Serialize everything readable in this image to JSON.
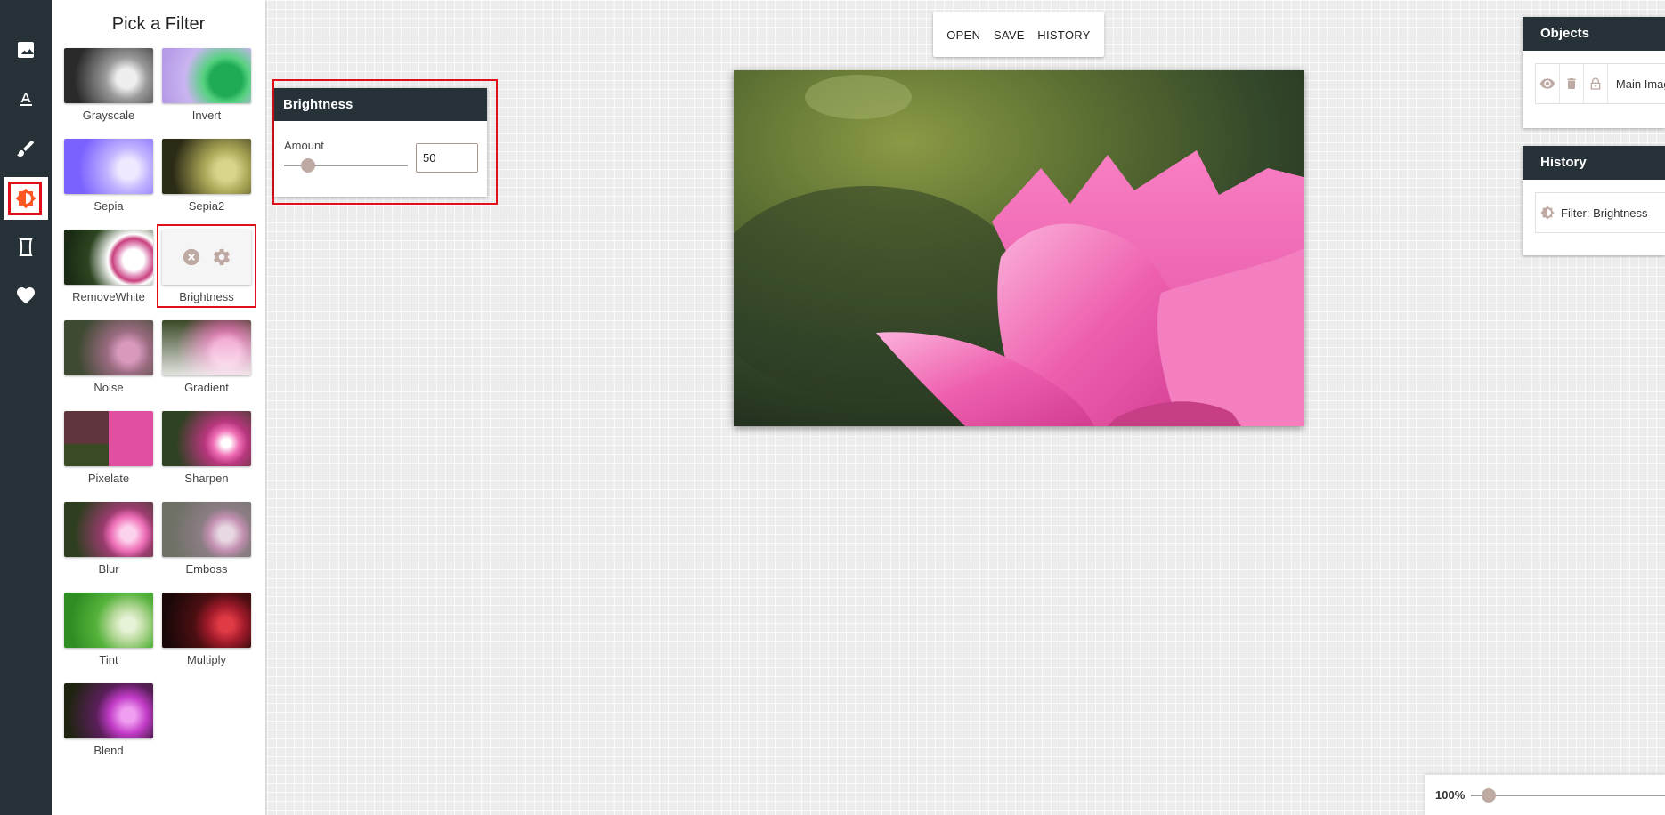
{
  "toolbar": {
    "tools": [
      {
        "name": "image",
        "icon": "image-icon"
      },
      {
        "name": "text",
        "icon": "text-format-icon"
      },
      {
        "name": "draw",
        "icon": "brush-icon"
      },
      {
        "name": "filters",
        "icon": "brightness-filter-icon",
        "active": true
      },
      {
        "name": "frame",
        "icon": "frame-icon"
      },
      {
        "name": "stickers",
        "icon": "heart-icon"
      }
    ]
  },
  "filter_panel": {
    "title": "Pick a Filter",
    "filters": [
      {
        "label": "Grayscale"
      },
      {
        "label": "Invert"
      },
      {
        "label": "Sepia"
      },
      {
        "label": "Sepia2"
      },
      {
        "label": "RemoveWhite"
      },
      {
        "label": "Brightness",
        "selected": true
      },
      {
        "label": "Noise"
      },
      {
        "label": "Gradient"
      },
      {
        "label": "Pixelate"
      },
      {
        "label": "Sharpen"
      },
      {
        "label": "Blur"
      },
      {
        "label": "Emboss"
      },
      {
        "label": "Tint"
      },
      {
        "label": "Multiply"
      },
      {
        "label": "Blend"
      }
    ]
  },
  "top_menu": {
    "open_label": "OPEN",
    "save_label": "SAVE",
    "history_label": "HISTORY"
  },
  "brightness_panel": {
    "title": "Brightness",
    "amount_label": "Amount",
    "amount_value": "50"
  },
  "objects_panel": {
    "title": "Objects",
    "item_label": "Main Image"
  },
  "history_panel": {
    "title": "History",
    "item_label": "Filter: Brightness"
  },
  "zoom": {
    "label": "100%"
  },
  "colors": {
    "toolbar_bg": "#263238",
    "accent_orange": "#ff5722",
    "highlight_red": "#e0101a",
    "slider_thumb": "#bfaaa3"
  }
}
